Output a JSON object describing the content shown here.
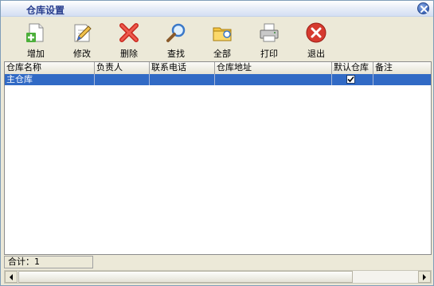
{
  "window": {
    "title": "仓库设置"
  },
  "toolbar": {
    "add": "增加",
    "edit": "修改",
    "delete": "删除",
    "find": "查找",
    "all": "全部",
    "print": "打印",
    "exit": "退出"
  },
  "grid": {
    "columns": [
      "仓库名称",
      "负责人",
      "联系电话",
      "仓库地址",
      "默认仓库",
      "备注"
    ],
    "rows": [
      {
        "name": "主仓库",
        "manager": "",
        "phone": "",
        "address": "",
        "default": true,
        "note": ""
      }
    ]
  },
  "status": {
    "total": "合计：1"
  },
  "colors": {
    "selection": "#316ac5",
    "title_text": "#2a3f8f",
    "face": "#ece9d8"
  }
}
